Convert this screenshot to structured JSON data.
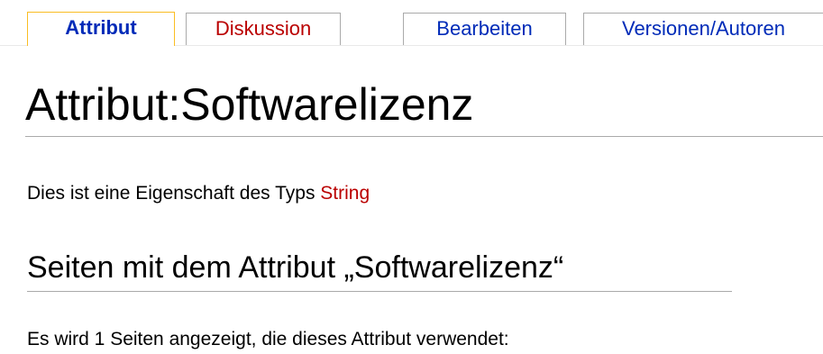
{
  "tabs": [
    {
      "label": "Attribut",
      "state": "selected"
    },
    {
      "label": "Diskussion",
      "state": "new"
    },
    {
      "label": "Bearbeiten",
      "state": "normal"
    },
    {
      "label": "Versionen/Autoren",
      "state": "normal"
    }
  ],
  "page": {
    "title": "Attribut:Softwarelizenz",
    "type_prefix": "Dies ist eine Eigenschaft des Typs ",
    "type_link": "String",
    "section_heading": "Seiten mit dem Attribut „Softwarelizenz“",
    "pages_count_text": "Es wird 1 Seiten angezeigt, die dieses Attribut verwendet:"
  },
  "colors": {
    "selected_tab_border": "#fabd23",
    "link_blue": "#002bb8",
    "link_red_new": "#ba0000",
    "rule_gray": "#aaaaaa"
  }
}
